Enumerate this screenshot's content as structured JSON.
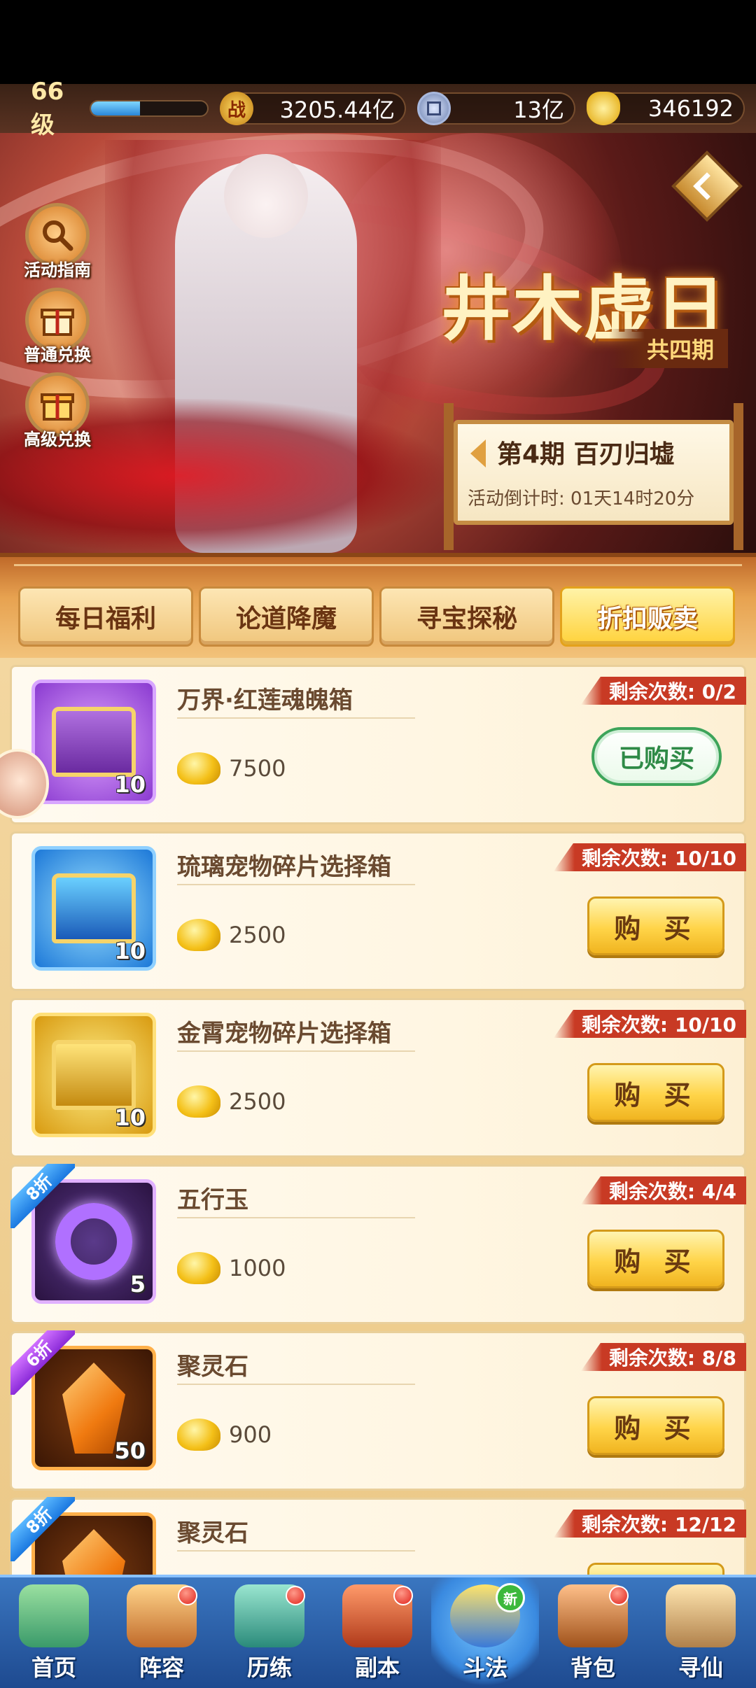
{
  "player": {
    "level": "66级",
    "exp_fraction": 0.42,
    "power": "3205.44亿",
    "power_icon_text": "战",
    "coins": "13亿",
    "gold": "346192"
  },
  "banner": {
    "event_title": "井木虚日",
    "event_subtitle": "共四期",
    "period_name": "第4期  百刃归墟",
    "countdown": "活动倒计时: 01天14时20分",
    "side_menu": [
      {
        "label": "活动指南",
        "icon": "magnifier-icon"
      },
      {
        "label": "普通兑换",
        "icon": "gift-box-icon"
      },
      {
        "label": "高级兑换",
        "icon": "gift-box-icon"
      }
    ]
  },
  "tabs": [
    {
      "label": "每日福利",
      "active": false
    },
    {
      "label": "论道降魔",
      "active": false
    },
    {
      "label": "寻宝探秘",
      "active": false
    },
    {
      "label": "折扣贩卖",
      "active": true
    }
  ],
  "shop": {
    "buy_label": "购 买",
    "bought_label": "已购买",
    "items": [
      {
        "name": "万界·红莲魂魄箱",
        "count": "10",
        "price": "7500",
        "remaining": "剩余次数: 0/2",
        "discount": "",
        "purchased": true
      },
      {
        "name": "琉璃宠物碎片选择箱",
        "count": "10",
        "price": "2500",
        "remaining": "剩余次数: 10/10",
        "discount": "",
        "purchased": false
      },
      {
        "name": "金霄宠物碎片选择箱",
        "count": "10",
        "price": "2500",
        "remaining": "剩余次数: 10/10",
        "discount": "",
        "purchased": false
      },
      {
        "name": "五行玉",
        "count": "5",
        "price": "1000",
        "remaining": "剩余次数: 4/4",
        "discount": "8折",
        "purchased": false
      },
      {
        "name": "聚灵石",
        "count": "50",
        "price": "900",
        "remaining": "剩余次数: 8/8",
        "discount": "6折",
        "purchased": false
      },
      {
        "name": "聚灵石",
        "count": "",
        "price": "",
        "remaining": "剩余次数: 12/12",
        "discount": "8折",
        "purchased": false
      }
    ]
  },
  "nav": {
    "new_badge": "新",
    "items": [
      {
        "label": "首页",
        "icon": "home-icon"
      },
      {
        "label": "阵容",
        "icon": "team-icon"
      },
      {
        "label": "历练",
        "icon": "train-icon"
      },
      {
        "label": "副本",
        "icon": "dungeon-icon"
      },
      {
        "label": "斗法",
        "icon": "arena-icon"
      },
      {
        "label": "背包",
        "icon": "bag-icon"
      },
      {
        "label": "寻仙",
        "icon": "seek-icon"
      }
    ]
  },
  "colors": {
    "accent_gold": "#ffd448",
    "remaining_red": "#c83a24",
    "bought_green": "#3da45a",
    "nav_blue": "#2a5ea8"
  }
}
